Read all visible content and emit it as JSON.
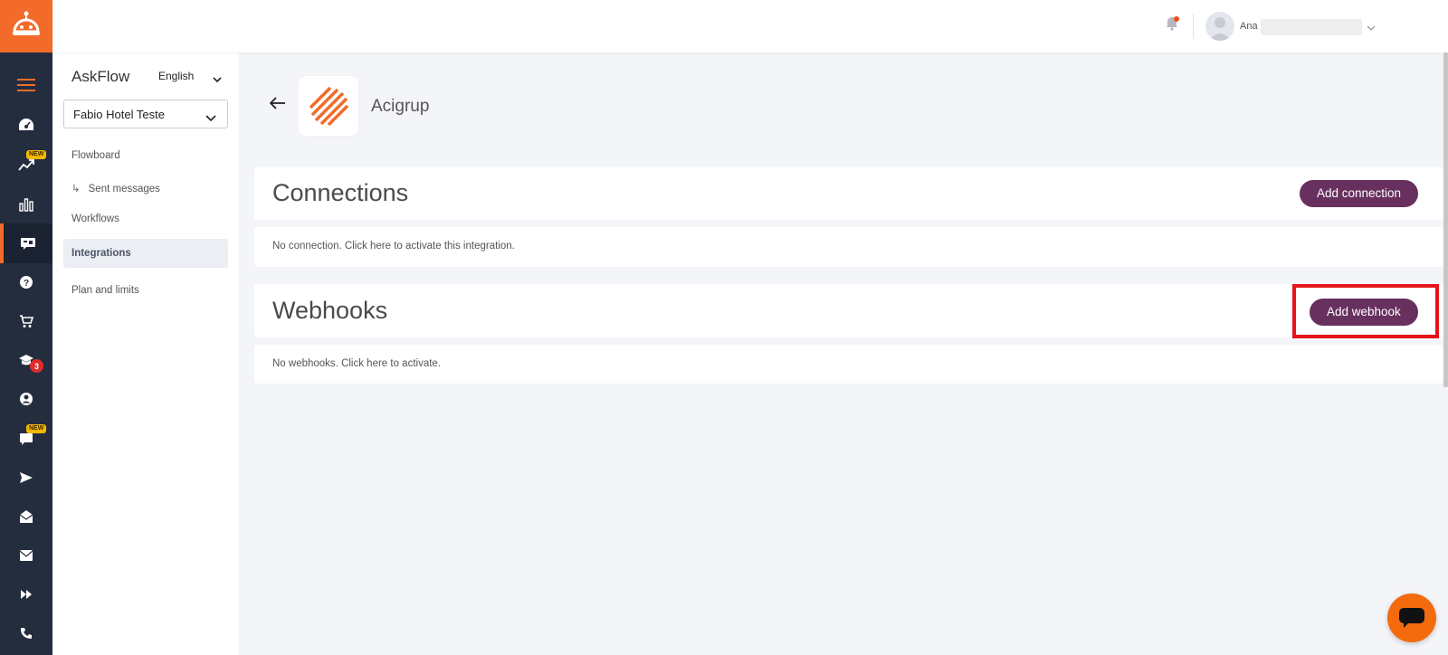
{
  "app": {
    "brand_color": "#f36b2a",
    "rail_color": "#242d3e",
    "accent_button_color": "#67305e"
  },
  "rail": {
    "items": [
      {
        "icon": "menu-icon"
      },
      {
        "icon": "dashboard-icon"
      },
      {
        "icon": "trending-icon",
        "badge": "NEW"
      },
      {
        "icon": "bar-chart-icon"
      },
      {
        "icon": "chat-flow-icon",
        "active": true
      },
      {
        "icon": "help-icon"
      },
      {
        "icon": "cart-icon"
      },
      {
        "icon": "graduation-icon",
        "count": "3"
      },
      {
        "icon": "account-icon"
      },
      {
        "icon": "messages-icon",
        "badge": "NEW"
      },
      {
        "icon": "send-icon"
      },
      {
        "icon": "mail-open-icon"
      },
      {
        "icon": "mail-icon"
      },
      {
        "icon": "fast-forward-icon"
      },
      {
        "icon": "phone-icon"
      }
    ]
  },
  "header": {
    "user_name": "Ana"
  },
  "sidebar": {
    "title": "AskFlow",
    "language": "English",
    "selected_account": "Fabio Hotel Teste",
    "links": {
      "flowboard": "Flowboard",
      "sent_messages": "Sent messages",
      "workflows": "Workflows",
      "integrations": "Integrations",
      "plan_limits": "Plan and limits"
    }
  },
  "integration": {
    "name": "Acigrup"
  },
  "connections": {
    "title": "Connections",
    "button": "Add connection",
    "empty_text": "No connection. Click here to activate this integration."
  },
  "webhooks": {
    "title": "Webhooks",
    "button": "Add webhook",
    "empty_text": "No webhooks. Click here to activate."
  }
}
